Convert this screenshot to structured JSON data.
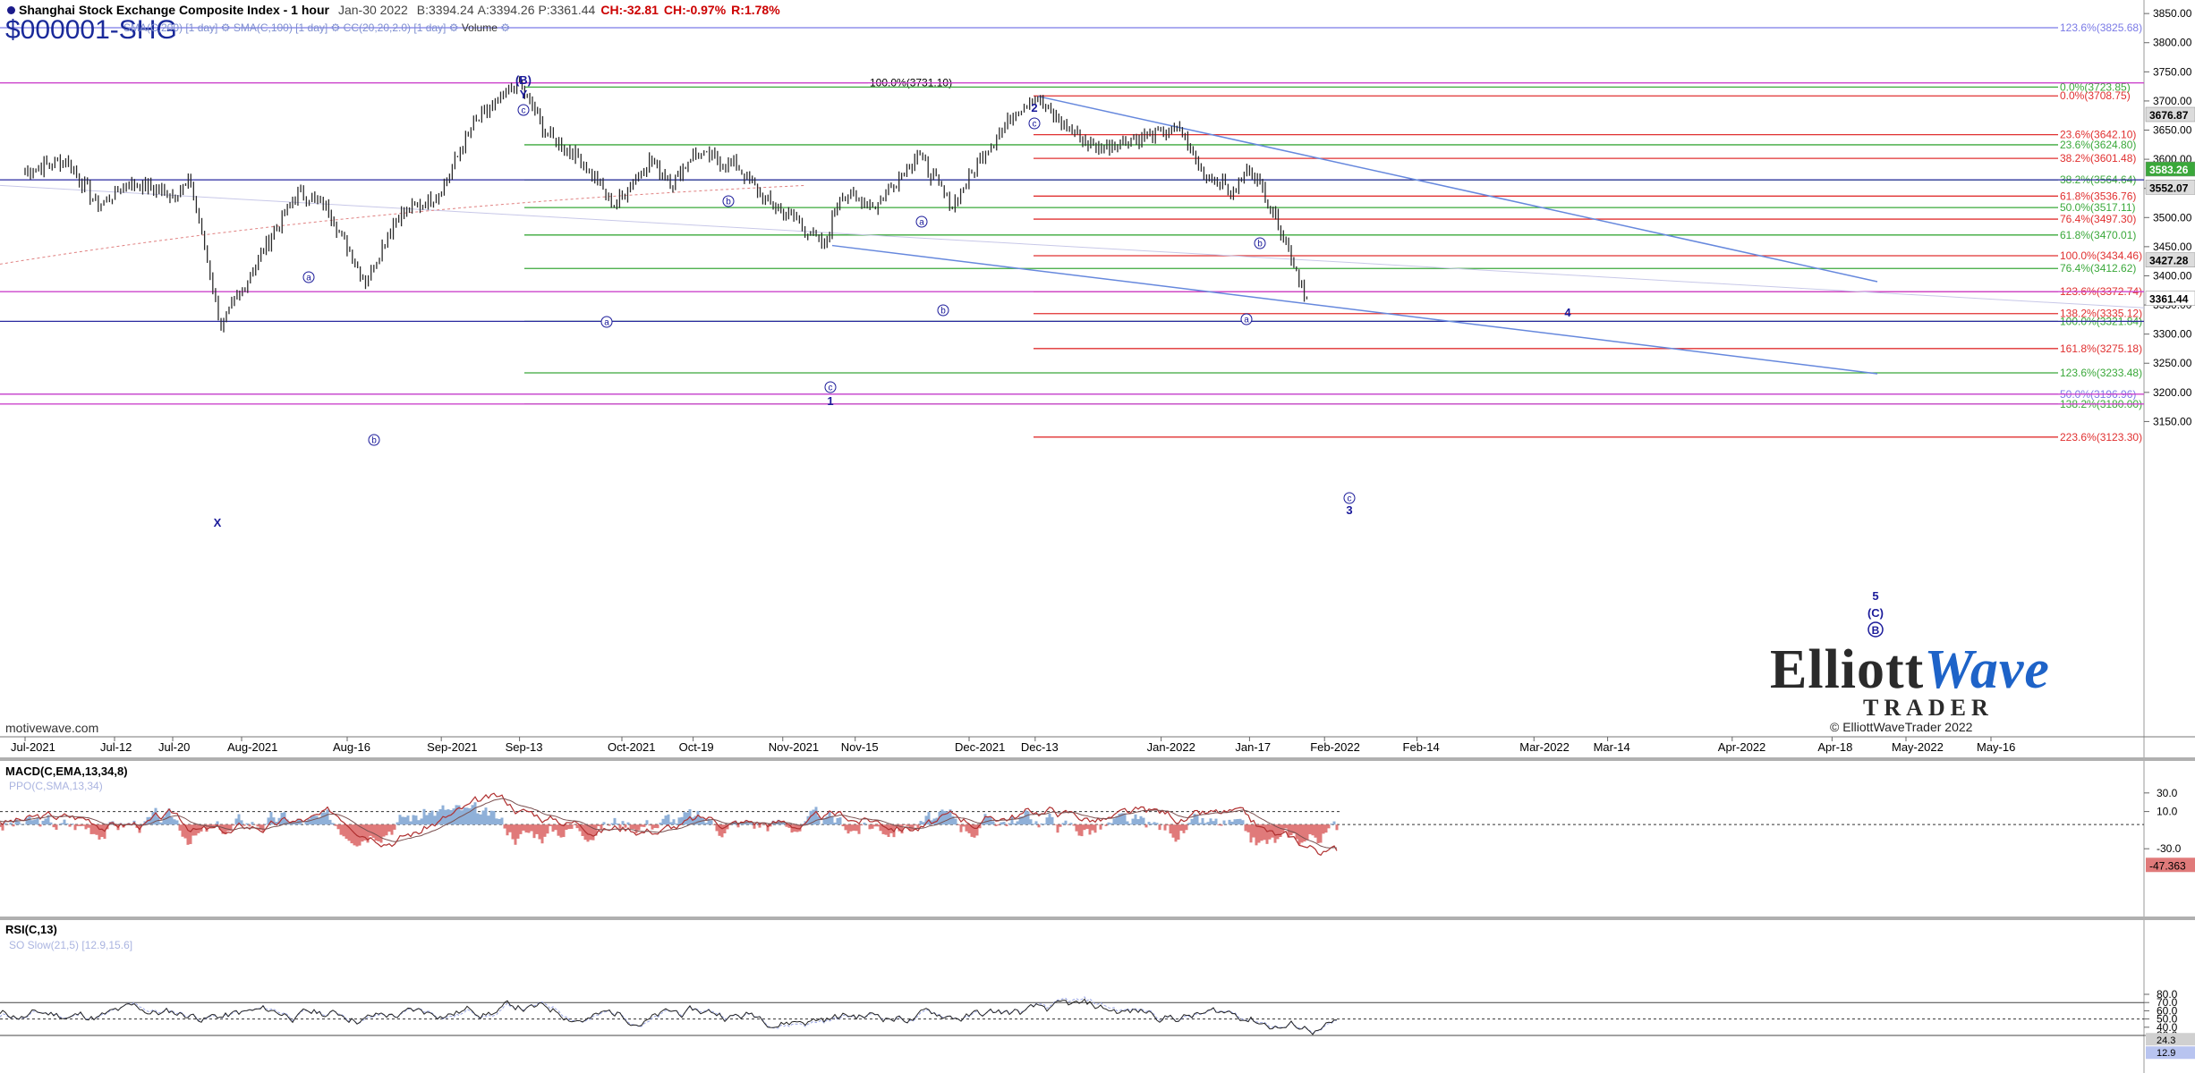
{
  "header": {
    "title": "Shanghai Stock Exchange Composite Index - 1 hour",
    "date": "Jan-30 2022",
    "bid": "B:3394.24",
    "ask": "A:3394.26",
    "price": "P:3361.44",
    "change": "CH:-32.81",
    "change_pct": "CH:-0.97%",
    "range": "R:1.78%"
  },
  "symbol": "$000001-SHG",
  "studies": {
    "items": [
      "SMA(C,200) [1 day]",
      "SMA(C,100) [1 day]",
      "CC(20,20,2.0) [1 day]",
      "Volume"
    ]
  },
  "watermark": "motivewave.com",
  "copyright": "© ElliottWaveTrader 2022",
  "logo": {
    "line1_a": "Elliott",
    "line1_b": "Wave",
    "line2": "TRADER"
  },
  "price_axis": {
    "ticks": [
      "3850.00",
      "3800.00",
      "3750.00",
      "3700.00",
      "3650.00",
      "3600.00",
      "3550.00",
      "3500.00",
      "3450.00",
      "3400.00",
      "3350.00",
      "3300.00",
      "3250.00",
      "3200.00",
      "3150.00"
    ],
    "badges": [
      {
        "label": "3676.87",
        "value": 3676.87,
        "bg": "#dcdcdc",
        "fg": "#000000"
      },
      {
        "label": "3583.26",
        "value": 3583.26,
        "bg": "#3aa83a",
        "fg": "#ffffff"
      },
      {
        "label": "3552.07",
        "value": 3552.07,
        "bg": "#dcdcdc",
        "fg": "#000000"
      },
      {
        "label": "3427.28",
        "value": 3427.28,
        "bg": "#dcdcdc",
        "fg": "#000000"
      },
      {
        "label": "3361.44",
        "value": 3361.44,
        "bg": "#ffffff",
        "fg": "#000000"
      }
    ]
  },
  "time_axis": {
    "labels": [
      "Jul-2021",
      "Jul-12",
      "Jul-20",
      "Aug-2021",
      "Aug-16",
      "Sep-2021",
      "Sep-13",
      "Oct-2021",
      "Oct-19",
      "Nov-2021",
      "Nov-15",
      "Dec-2021",
      "Dec-13",
      "Jan-2022",
      "Jan-17",
      "Feb-2022",
      "Feb-14",
      "Mar-2022",
      "Mar-14",
      "Apr-2022",
      "Apr-18",
      "May-2022",
      "May-16"
    ]
  },
  "macd": {
    "title": "MACD(C,EMA,13,34,8)",
    "sub": "PPO(C,SMA,13,34)",
    "ticks": [
      "30.0",
      "10.0",
      "-30.0"
    ],
    "last": "-47.363"
  },
  "rsi": {
    "title": "RSI(C,13)",
    "sub": "SO Slow(21,5) [12.9,15.6]",
    "ticks": [
      "80.0",
      "70.0",
      "60.0",
      "50.0",
      "40.0",
      "30.0"
    ],
    "last_a": "24.3",
    "last_b": "12.9"
  },
  "colors": {
    "wave": "#1a1a9a",
    "fib_green": "#3aa83a",
    "fib_red": "#e03030",
    "magenta": "#cc44cc",
    "trend": "#6688dd",
    "price": "#2b2b2b"
  },
  "chart_data": {
    "type": "candlestick",
    "title": "Shanghai Stock Exchange Composite Index - 1 hour",
    "ylim": [
      3110,
      3870
    ],
    "x_range": [
      "Jul-2021",
      "May-2022"
    ],
    "key_points": [
      {
        "label": "start",
        "date": "Jul-2021",
        "value": 3580
      },
      {
        "label": "X",
        "date": "Jul-28",
        "value": 3312
      },
      {
        "label": "(B) Y",
        "date": "Sep-13",
        "value": 3731.1
      },
      {
        "label": "1",
        "date": "Nov-09",
        "value": 3449
      },
      {
        "label": "2",
        "date": "Dec-13",
        "value": 3708
      },
      {
        "label": "last",
        "date": "Jan-28",
        "value": 3361.44
      }
    ],
    "fib_levels": [
      {
        "label": "123.6%(3825.68)",
        "value": 3825.68,
        "color": "#7a7ae6"
      },
      {
        "label": "100.0%(3731.10)",
        "value": 3731.1,
        "color": "#888888"
      },
      {
        "label": "0.0%(3723.85)",
        "value": 3723.85,
        "color": "#3aa83a"
      },
      {
        "label": "0.0%(3708.75)",
        "value": 3708.75,
        "color": "#e03030"
      },
      {
        "label": "23.6%(3642.10)",
        "value": 3642.1,
        "color": "#e03030"
      },
      {
        "label": "23.6%(3624.80)",
        "value": 3624.8,
        "color": "#3aa83a"
      },
      {
        "label": "38.2%(3601.48)",
        "value": 3601.48,
        "color": "#e03030"
      },
      {
        "label": "38.2%(3564.64)",
        "value": 3564.64,
        "color": "#3aa83a"
      },
      {
        "label": "61.8%(3536.76)",
        "value": 3536.76,
        "color": "#e03030"
      },
      {
        "label": "50.0%(3517.11)",
        "value": 3517.11,
        "color": "#3aa83a"
      },
      {
        "label": "76.4%(3497.30)",
        "value": 3497.3,
        "color": "#e03030"
      },
      {
        "label": "61.8%(3470.01)",
        "value": 3470.01,
        "color": "#3aa83a"
      },
      {
        "label": "100.0%(3434.46)",
        "value": 3434.46,
        "color": "#e03030"
      },
      {
        "label": "76.4%(3412.62)",
        "value": 3412.62,
        "color": "#3aa83a"
      },
      {
        "label": "123.6%(3372.74)",
        "value": 3372.74,
        "color": "#e03030"
      },
      {
        "label": "138.2%(3335.12)",
        "value": 3335.12,
        "color": "#e03030"
      },
      {
        "label": "100.0%(3321.84)",
        "value": 3321.84,
        "color": "#3aa83a"
      },
      {
        "label": "161.8%(3275.18)",
        "value": 3275.18,
        "color": "#e03030"
      },
      {
        "label": "123.6%(3233.48)",
        "value": 3233.48,
        "color": "#3aa83a"
      },
      {
        "label": "50.0%(3196.96)",
        "value": 3196.96,
        "color": "#7a7ae6"
      },
      {
        "label": "138.2%(3180.00)",
        "value": 3180.0,
        "color": "#3aa83a"
      },
      {
        "label": "223.6%(3123.30)",
        "value": 3123.3,
        "color": "#e03030"
      }
    ],
    "wave_labels": [
      {
        "text": "(B)",
        "date": "Sep-13",
        "value": 3731
      },
      {
        "text": "Y",
        "date": "Sep-13",
        "value": 3731
      },
      {
        "text": "X",
        "date": "Jul-28",
        "value": 3312
      },
      {
        "text": "1",
        "date": "Nov-09",
        "value": 3449
      },
      {
        "text": "2",
        "date": "Dec-13",
        "value": 3708
      },
      {
        "text": "3",
        "date": "Jan-28",
        "value": 3340
      },
      {
        "text": "4",
        "date": "Mar-04",
        "value": 3521
      },
      {
        "text": "5",
        "date": "Apr-22",
        "value": 3230
      },
      {
        "text": "(C)",
        "date": "Apr-22",
        "value": 3230
      },
      {
        "text": "B",
        "date": "Apr-22",
        "value": 3230
      }
    ]
  }
}
